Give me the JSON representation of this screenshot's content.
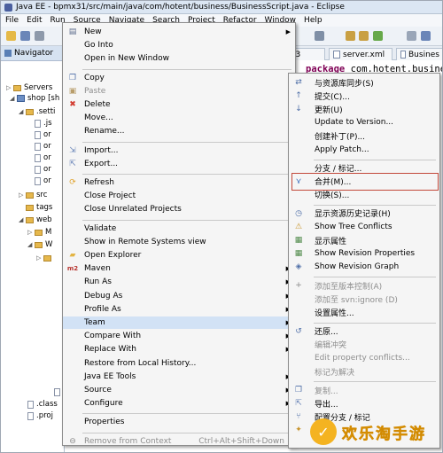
{
  "title": "Java EE - bpmx31/src/main/java/com/hotent/business/BusinessScript.java - Eclipse",
  "menubar": [
    "File",
    "Edit",
    "Run",
    "Source",
    "Navigate",
    "Search",
    "Project",
    "Refactor",
    "Window",
    "Help"
  ],
  "navigator": {
    "title": "Navigator",
    "tree": [
      {
        "label": "Servers",
        "kind": "folder",
        "twisty": "▷"
      },
      {
        "label": "shop [sh",
        "kind": "project",
        "twisty": "◢"
      },
      {
        "label": ".setti",
        "kind": "folder",
        "twisty": "◢"
      },
      {
        "label": ".js",
        "kind": "file",
        "twisty": ""
      },
      {
        "label": "or",
        "kind": "file",
        "twisty": ""
      },
      {
        "label": "or",
        "kind": "file",
        "twisty": ""
      },
      {
        "label": "or",
        "kind": "file",
        "twisty": ""
      },
      {
        "label": "or",
        "kind": "file",
        "twisty": ""
      },
      {
        "label": "or",
        "kind": "file",
        "twisty": ""
      },
      {
        "label": "src",
        "kind": "folder",
        "twisty": "▷"
      },
      {
        "label": "tags",
        "kind": "folder",
        "twisty": ""
      },
      {
        "label": "web",
        "kind": "folder",
        "twisty": "◢"
      },
      {
        "label": "M",
        "kind": "folder",
        "twisty": "▷"
      },
      {
        "label": "W",
        "kind": "folder",
        "twisty": "◢"
      },
      {
        "label": "",
        "kind": "folder",
        "twisty": "▷"
      },
      {
        "label": "re",
        "kind": "file",
        "twisty": ""
      },
      {
        "label": ".class",
        "kind": "file",
        "twisty": ""
      },
      {
        "label": ".proj",
        "kind": "file",
        "twisty": ""
      }
    ]
  },
  "editor": {
    "tabs": [
      "bpmx3",
      "server.xml",
      "Busines"
    ],
    "keyword": "package",
    "code": " com.hotent.busine"
  },
  "context_menu": [
    {
      "label": "New",
      "icon": "new-icon",
      "arrow": true
    },
    {
      "label": "Go Into"
    },
    {
      "label": "Open in New Window"
    },
    {
      "sep": true
    },
    {
      "label": "Copy",
      "icon": "copy-icon"
    },
    {
      "label": "Paste",
      "icon": "paste-icon",
      "disabled": true
    },
    {
      "label": "Delete",
      "icon": "delete-icon"
    },
    {
      "label": "Move..."
    },
    {
      "label": "Rename..."
    },
    {
      "sep": true
    },
    {
      "label": "Import...",
      "icon": "import-icon"
    },
    {
      "label": "Export...",
      "icon": "export-icon"
    },
    {
      "sep": true
    },
    {
      "label": "Refresh",
      "icon": "refresh-icon"
    },
    {
      "label": "Close Project"
    },
    {
      "label": "Close Unrelated Projects"
    },
    {
      "sep": true
    },
    {
      "label": "Validate"
    },
    {
      "label": "Show in Remote Systems view"
    },
    {
      "label": "Open Explorer",
      "icon": "folder-icon"
    },
    {
      "label": "Maven",
      "icon": "maven-icon",
      "arrow": true
    },
    {
      "label": "Run As",
      "arrow": true
    },
    {
      "label": "Debug As",
      "arrow": true
    },
    {
      "label": "Profile As",
      "arrow": true
    },
    {
      "label": "Team",
      "arrow": true,
      "highlight": true
    },
    {
      "label": "Compare With",
      "arrow": true
    },
    {
      "label": "Replace With",
      "arrow": true
    },
    {
      "label": "Restore from Local History..."
    },
    {
      "label": "Java EE Tools",
      "arrow": true
    },
    {
      "label": "Source",
      "arrow": true
    },
    {
      "label": "Configure",
      "arrow": true
    },
    {
      "sep": true
    },
    {
      "label": "Properties"
    },
    {
      "sep": true
    },
    {
      "label": "Remove from Context",
      "icon": "remove-context-icon",
      "shortcut": "Ctrl+Alt+Shift+Down",
      "disabled": true
    }
  ],
  "team_menu": [
    {
      "label": "与资源库同步(S)",
      "icon": "sync-icon"
    },
    {
      "label": "提交(C)...",
      "icon": "commit-icon"
    },
    {
      "label": "更新(U)",
      "icon": "update-icon"
    },
    {
      "label": "Update to Version..."
    },
    {
      "label": "创建补丁(P)..."
    },
    {
      "label": "Apply Patch..."
    },
    {
      "sep": true
    },
    {
      "label": "分支 / 标记..."
    },
    {
      "label": "合并(M)...",
      "icon": "merge-icon"
    },
    {
      "label": "切换(S)..."
    },
    {
      "sep": true
    },
    {
      "label": "显示资源历史记录(H)",
      "icon": "history-icon"
    },
    {
      "label": "Show Tree Conflicts",
      "icon": "tree-conflicts-icon"
    },
    {
      "label": "显示属性",
      "icon": "properties-icon"
    },
    {
      "label": "Show Revision Properties",
      "icon": "revision-properties-icon"
    },
    {
      "label": "Show Revision Graph",
      "icon": "revision-graph-icon"
    },
    {
      "sep": true
    },
    {
      "label": "添加至版本控制(A)",
      "icon": "add-vc-icon",
      "disabled": true
    },
    {
      "label": "添加至 svn:ignore (D)",
      "disabled": true
    },
    {
      "label": "设置属性..."
    },
    {
      "sep": true
    },
    {
      "label": "还原...",
      "icon": "revert-icon"
    },
    {
      "label": "编辑冲突",
      "disabled": true
    },
    {
      "label": "Edit property conflicts...",
      "disabled": true
    },
    {
      "label": "标记为解决",
      "disabled": true
    },
    {
      "sep": true
    },
    {
      "label": "复制...",
      "icon": "copy-icon",
      "disabled": true
    },
    {
      "label": "导出...",
      "icon": "export-icon"
    },
    {
      "label": "配置分支 / 标记",
      "icon": "config-branch-icon"
    },
    {
      "label": "清理",
      "icon": "cleanup-icon"
    }
  ],
  "watermark": "欢乐淘手游",
  "colors": {
    "highlight": "#d2e2f5",
    "merge_box": "#c2483a",
    "watermark": "#f4b321",
    "keyword": "#7f0055"
  }
}
